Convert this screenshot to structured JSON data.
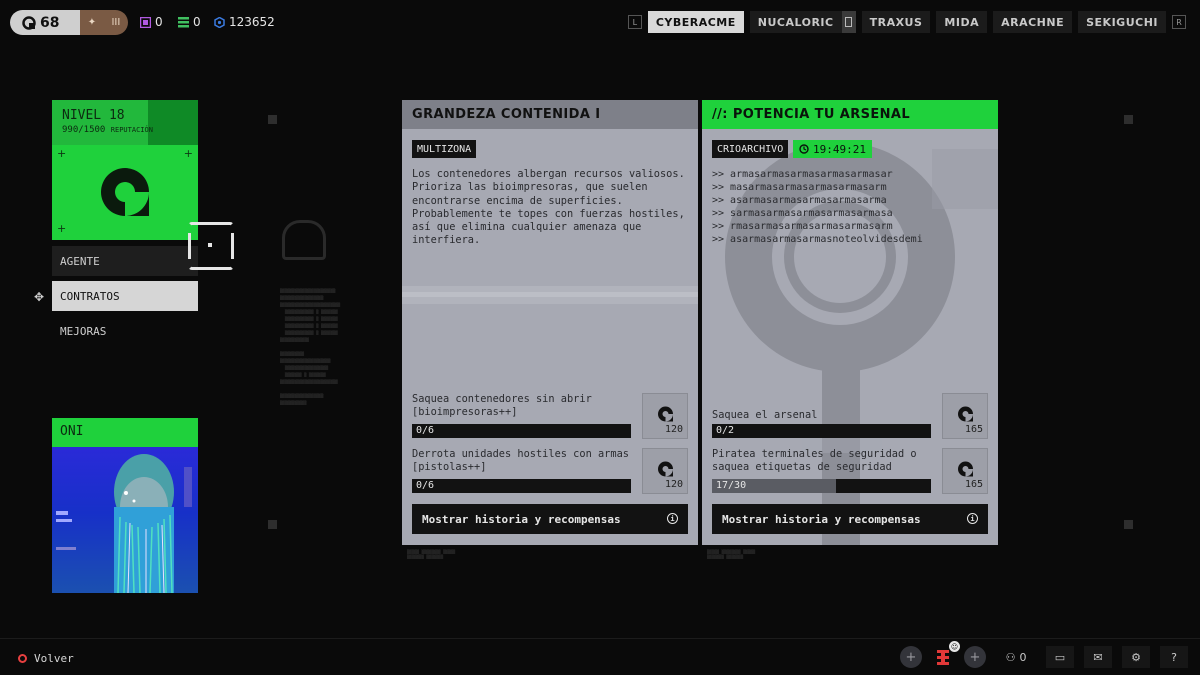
{
  "topbar": {
    "player_level": "68",
    "rank_roman": "III",
    "resources": [
      {
        "name": "purple-chip",
        "value": "0",
        "color": "#b05ae0"
      },
      {
        "name": "green-stack",
        "value": "0",
        "color": "#40c060"
      },
      {
        "name": "credits",
        "value": "123652",
        "color": "#3a7ae0"
      }
    ],
    "faction_key_left": "L",
    "faction_key_right": "R",
    "factions": [
      "CYBERACME",
      "NUCALORIC",
      "TRAXUS",
      "MIDA",
      "ARACHNE",
      "SEKIGUCHI"
    ],
    "active_faction": "CYBERACME"
  },
  "level_card": {
    "title": "NIVEL 18",
    "rep_value": "990/1500",
    "rep_label": "REPUTACIÓN",
    "rep_progress": 0.66
  },
  "menu": {
    "agent": "AGENTE",
    "contracts": "CONTRATOS",
    "upgrades": "MEJORAS"
  },
  "agent_card": {
    "name": "ONI"
  },
  "contracts": [
    {
      "title": "GRANDEZA CONTENIDA I",
      "tag": "MULTIZONA",
      "description": "Los contenedores albergan recursos valiosos. Prioriza las bioimpresoras, que suelen encontrarse encima de superficies. Probablemente te topes con fuerzas hostiles, así que elimina cualquier amenaza que interfiera.",
      "objectives": [
        {
          "text": "Saquea contenedores sin abrir [bioimpresoras++]",
          "progress": "0/6",
          "fraction": 0,
          "reward": "120"
        },
        {
          "text": "Derrota unidades hostiles con armas [pistolas++]",
          "progress": "0/6",
          "fraction": 0,
          "reward": "120"
        }
      ],
      "button": "Mostrar historia y recompensas"
    },
    {
      "title": "//: POTENCIA TU ARSENAL",
      "tag": "CRIOARCHIVO",
      "timer": "19:49:21",
      "code_lines": [
        ">> armasarmasarmasarmasarmasar",
        ">> masarmasarmasarmasarmasarm",
        ">> asarmasarmasarmasarmasarma",
        ">> sarmasarmasarmasarmasarmasa",
        ">> rmasarmasarmasarmasarmasarm",
        ">> asarmasarmasarmasnoteolvidesdemi"
      ],
      "objectives": [
        {
          "text": "Saquea el arsenal",
          "progress": "0/2",
          "fraction": 0,
          "reward": "165"
        },
        {
          "text": "Piratea terminales de seguridad o saquea etiquetas de seguridad",
          "progress": "17/30",
          "fraction": 0.5667,
          "reward": "165"
        }
      ],
      "button": "Mostrar historia y recompensas"
    }
  ],
  "bottombar": {
    "back_label": "Volver",
    "crew_count": "0"
  }
}
